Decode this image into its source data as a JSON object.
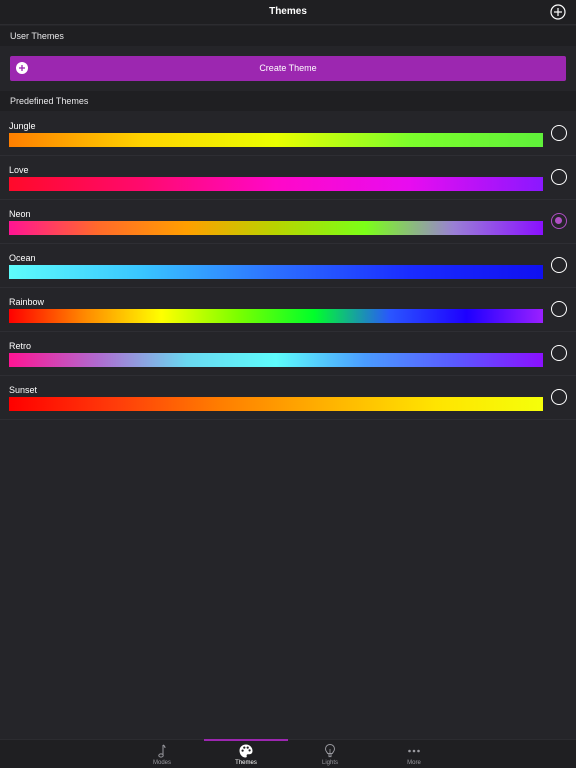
{
  "navbar": {
    "title": "Themes",
    "add_icon": "plus-circle-icon"
  },
  "sections": {
    "user_themes": "User Themes",
    "predefined_themes": "Predefined Themes"
  },
  "create_button": {
    "label": "Create Theme",
    "icon": "plus-circle-icon",
    "color": "#9c27b0"
  },
  "themes": [
    {
      "name": "Jungle",
      "selected": false,
      "colors": [
        "#ff7f00",
        "#ffd400",
        "#eaff00",
        "#7cff2b",
        "#5ff13a"
      ]
    },
    {
      "name": "Love",
      "selected": false,
      "colors": [
        "#ff0a2a",
        "#ff0a6e",
        "#ff08c8",
        "#e80cf0",
        "#8a18ff"
      ]
    },
    {
      "name": "Neon",
      "selected": true,
      "colors": [
        "#ff1493",
        "#ff6a2a",
        "#ff9f00",
        "#b8d400",
        "#7bff18",
        "#9a7fd6",
        "#8a10ff"
      ]
    },
    {
      "name": "Ocean",
      "selected": false,
      "colors": [
        "#5efcfb",
        "#39c5ff",
        "#2c6fff",
        "#1a2cff",
        "#1010f0"
      ]
    },
    {
      "name": "Rainbow",
      "selected": false,
      "colors": [
        "#ff0000",
        "#ff8a00",
        "#ffff00",
        "#7bff00",
        "#00ff2a",
        "#2a55ff",
        "#1e00ff",
        "#9b20ff"
      ]
    },
    {
      "name": "Retro",
      "selected": false,
      "colors": [
        "#ff1493",
        "#b06bd0",
        "#6ad8f0",
        "#5efcfb",
        "#4a9cff",
        "#5a5aff",
        "#8a10ff"
      ]
    },
    {
      "name": "Sunset",
      "selected": false,
      "colors": [
        "#ff0000",
        "#ff3c0a",
        "#ff7f00",
        "#ffb300",
        "#ffe400",
        "#f5ff0a"
      ]
    }
  ],
  "accent_color": "#9c27b0",
  "tabs": [
    {
      "label": "Modes",
      "icon": "music-note-icon",
      "active": false
    },
    {
      "label": "Themes",
      "icon": "palette-icon",
      "active": true
    },
    {
      "label": "Lights",
      "icon": "light-bulb-icon",
      "active": false
    },
    {
      "label": "More",
      "icon": "more-dots-icon",
      "active": false
    }
  ]
}
